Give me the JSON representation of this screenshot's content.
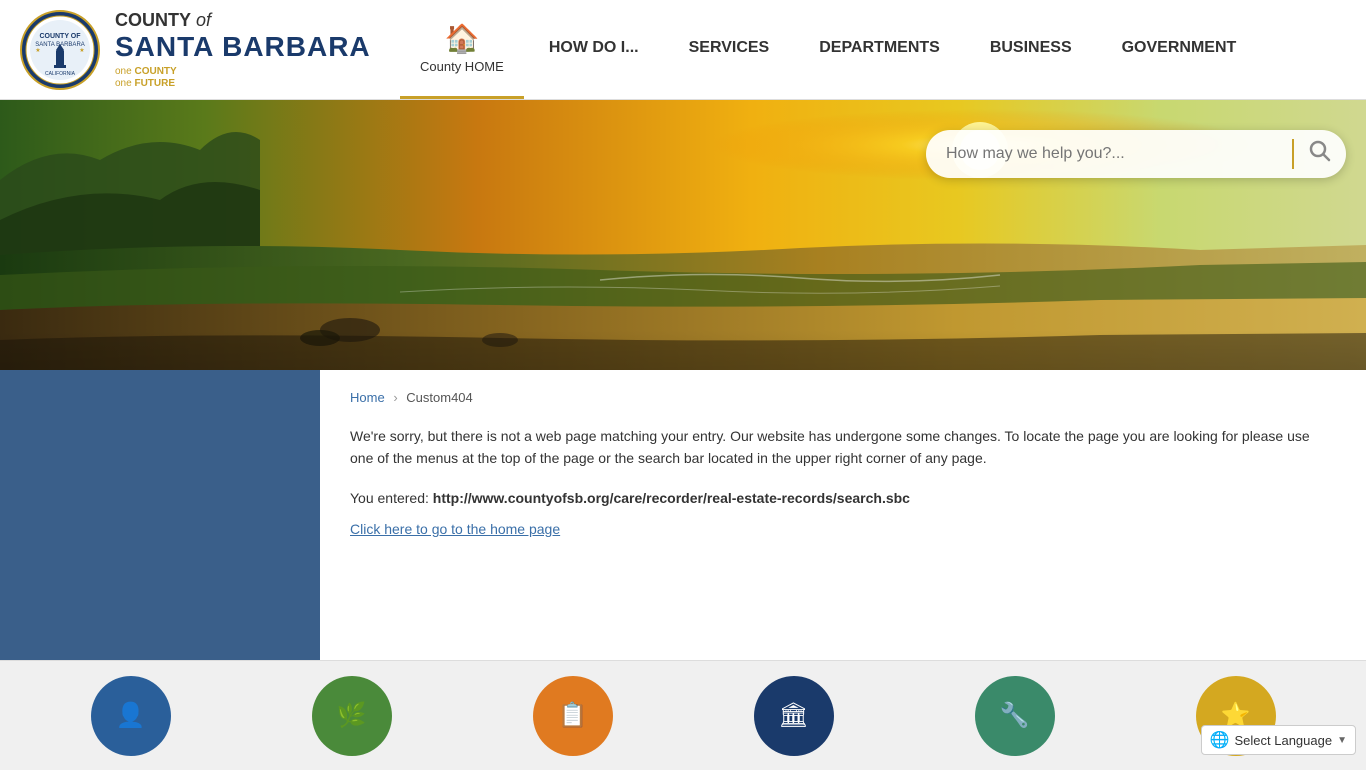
{
  "header": {
    "logo": {
      "county_of_label": "COUNTY",
      "of_italic": "of",
      "santa_barbara": "SANTA BARBARA",
      "tagline": "one COUNTY one FUTURE"
    },
    "nav": {
      "home_label": "County HOME",
      "items": [
        {
          "id": "how-do-i",
          "label": "HOW DO I..."
        },
        {
          "id": "services",
          "label": "SERVICES"
        },
        {
          "id": "departments",
          "label": "DEPARTMENTS"
        },
        {
          "id": "business",
          "label": "BUSINESS"
        },
        {
          "id": "government",
          "label": "GOVERNMENT"
        }
      ]
    }
  },
  "search": {
    "placeholder": "How may we help you?...",
    "button_label": "🔍"
  },
  "breadcrumb": {
    "home": "Home",
    "current": "Custom404"
  },
  "error_page": {
    "message": "We're sorry, but there is not a web page matching your entry. Our website has undergone some changes. To locate the page you are looking for please use one of the menus at the top of the page or the search bar located in the upper right corner of any page.",
    "entered_prefix": "You entered: ",
    "entered_url": "http://www.countyofsb.org/care/recorder/real-estate-records/search.sbc",
    "home_link": "Click here to go to the home page"
  },
  "language": {
    "label": "Select Language",
    "arrow": "▼"
  },
  "circles": [
    {
      "color": "circle-blue",
      "icon": "👤"
    },
    {
      "color": "circle-green",
      "icon": "🌿"
    },
    {
      "color": "circle-orange",
      "icon": "📋"
    },
    {
      "color": "circle-navy",
      "icon": "🏛"
    },
    {
      "color": "circle-teal",
      "icon": "🔧"
    },
    {
      "color": "circle-yellow",
      "icon": "⭐"
    }
  ]
}
